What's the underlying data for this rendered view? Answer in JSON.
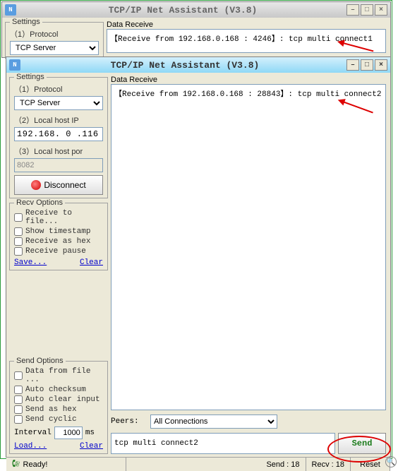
{
  "app_title": "TCP/IP Net Assistant (V3.8)",
  "back": {
    "settings_legend": "Settings",
    "protocol_label": "（1）Protocol",
    "protocol_value": "TCP Server",
    "data_receive_label": "Data Receive",
    "receive_text": "【Receive from 192.168.0.168 : 4246】: tcp multi connect1"
  },
  "front": {
    "settings_legend": "Settings",
    "protocol_label": "（1）Protocol",
    "protocol_value": "TCP Server",
    "localip_label": "（2）Local host IP",
    "localip_value": "192.168. 0 .116",
    "localport_label": "（3）Local host por",
    "localport_value": "8082",
    "disconnect_label": "Disconnect",
    "data_receive_label": "Data Receive",
    "receive_text": "【Receive from 192.168.0.168 : 28843】: tcp multi connect2"
  },
  "recv_options": {
    "legend": "Recv Options",
    "to_file": "Receive to file...",
    "timestamp": "Show timestamp",
    "as_hex": "Receive as hex",
    "pause": "Receive pause",
    "save": "Save...",
    "clear": "Clear"
  },
  "send_options": {
    "legend": "Send Options",
    "from_file": "Data from file ...",
    "checksum": "Auto checksum",
    "clear_input": "Auto clear input",
    "as_hex": "Send as hex",
    "cyclic": "Send cyclic",
    "interval_label": "Interval",
    "interval_value": "1000",
    "interval_unit": "ms",
    "load": "Load...",
    "clear": "Clear"
  },
  "peers": {
    "label": "Peers:",
    "value": "All Connections"
  },
  "send": {
    "input_value": "tcp multi connect2",
    "button": "Send"
  },
  "status": {
    "ready": "Ready!",
    "send": "Send : 18",
    "recv": "Recv : 18",
    "reset": "Reset"
  }
}
